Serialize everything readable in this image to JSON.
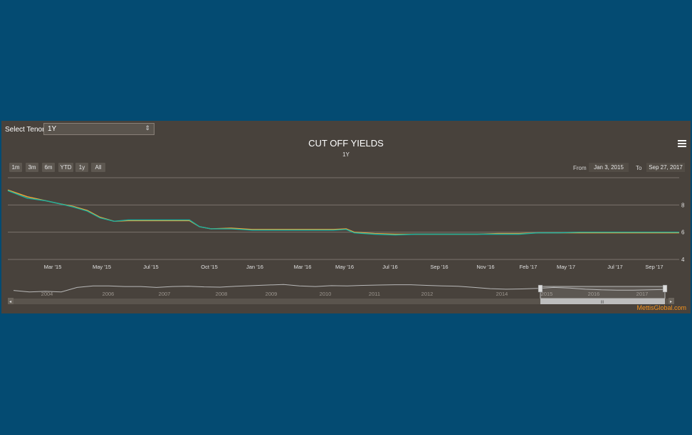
{
  "controls": {
    "select_label": "Select Tenor",
    "select_value": "1Y",
    "range_buttons": [
      "1m",
      "3m",
      "6m",
      "YTD",
      "1y",
      "All"
    ],
    "from_label": "From",
    "from_value": "Jan 3, 2015",
    "to_label": "To",
    "to_value": "Sep 27, 2017"
  },
  "colors": {
    "series_a": "#f4a637",
    "series_b": "#1aaf9f",
    "navigator_line": "#b8b8b8",
    "background": "#48423c",
    "credit": "#f7941d"
  },
  "chart_data": {
    "type": "line",
    "title": "CUT OFF YIELDS",
    "subtitle": "1Y",
    "ylim": [
      4,
      10
    ],
    "yticks": [
      4,
      6,
      8
    ],
    "xticks": [
      "Mar '15",
      "May '15",
      "Jul '15",
      "Oct '15",
      "Jan '16",
      "Mar '16",
      "May '16",
      "Jul '16",
      "Sep '16",
      "Nov '16",
      "Feb '17",
      "May '17",
      "Jul '17",
      "Sep '17"
    ],
    "x": [
      "2015-01-03",
      "2015-02-01",
      "2015-03-01",
      "2015-03-20",
      "2015-04-10",
      "2015-05-01",
      "2015-05-20",
      "2015-06-10",
      "2015-07-01",
      "2015-08-01",
      "2015-09-01",
      "2015-09-30",
      "2015-10-15",
      "2015-11-01",
      "2015-12-01",
      "2016-01-01",
      "2016-02-01",
      "2016-03-01",
      "2016-04-01",
      "2016-05-01",
      "2016-05-20",
      "2016-06-01",
      "2016-07-01",
      "2016-08-01",
      "2016-09-01",
      "2016-10-01",
      "2016-11-01",
      "2016-12-01",
      "2017-01-01",
      "2017-02-01",
      "2017-03-01",
      "2017-04-01",
      "2017-05-01",
      "2017-06-01",
      "2017-07-01",
      "2017-08-01",
      "2017-09-27"
    ],
    "series": [
      {
        "values": [
          9.1,
          8.6,
          8.3,
          8.1,
          7.9,
          7.6,
          7.1,
          6.8,
          6.85,
          6.85,
          6.85,
          6.85,
          6.4,
          6.25,
          6.3,
          6.2,
          6.2,
          6.2,
          6.2,
          6.2,
          6.25,
          6.0,
          5.9,
          5.85,
          5.85,
          5.85,
          5.85,
          5.85,
          5.9,
          5.9,
          5.95,
          5.95,
          5.95,
          5.95,
          5.95,
          5.95,
          5.95
        ]
      },
      {
        "values": [
          9.05,
          8.5,
          8.3,
          8.1,
          7.85,
          7.55,
          7.05,
          6.8,
          6.9,
          6.9,
          6.9,
          6.9,
          6.4,
          6.25,
          6.25,
          6.15,
          6.15,
          6.15,
          6.15,
          6.15,
          6.2,
          5.95,
          5.85,
          5.8,
          5.85,
          5.85,
          5.85,
          5.85,
          5.85,
          5.85,
          5.95,
          5.95,
          6.0,
          6.0,
          6.0,
          6.0,
          6.0
        ]
      }
    ],
    "navigator": {
      "years": [
        "2004",
        "2006",
        "2007",
        "2008",
        "2009",
        "2010",
        "2011",
        "2012",
        "2014",
        "2015",
        "2016",
        "2017"
      ],
      "values": [
        10.0,
        9.5,
        9.7,
        9.5,
        11.0,
        11.5,
        11.5,
        11.3,
        11.3,
        11.0,
        11.3,
        11.4,
        11.2,
        11.1,
        11.4,
        11.6,
        11.8,
        12.0,
        11.5,
        11.3,
        11.6,
        11.5,
        11.7,
        11.8,
        11.9,
        11.9,
        11.7,
        11.5,
        11.4,
        11.0,
        10.6,
        10.4,
        10.5,
        10.7,
        11.0,
        10.8,
        10.4,
        10.2,
        10.1,
        10.1,
        10.2,
        10.3
      ]
    }
  },
  "credit": "MettisGlobal.com"
}
